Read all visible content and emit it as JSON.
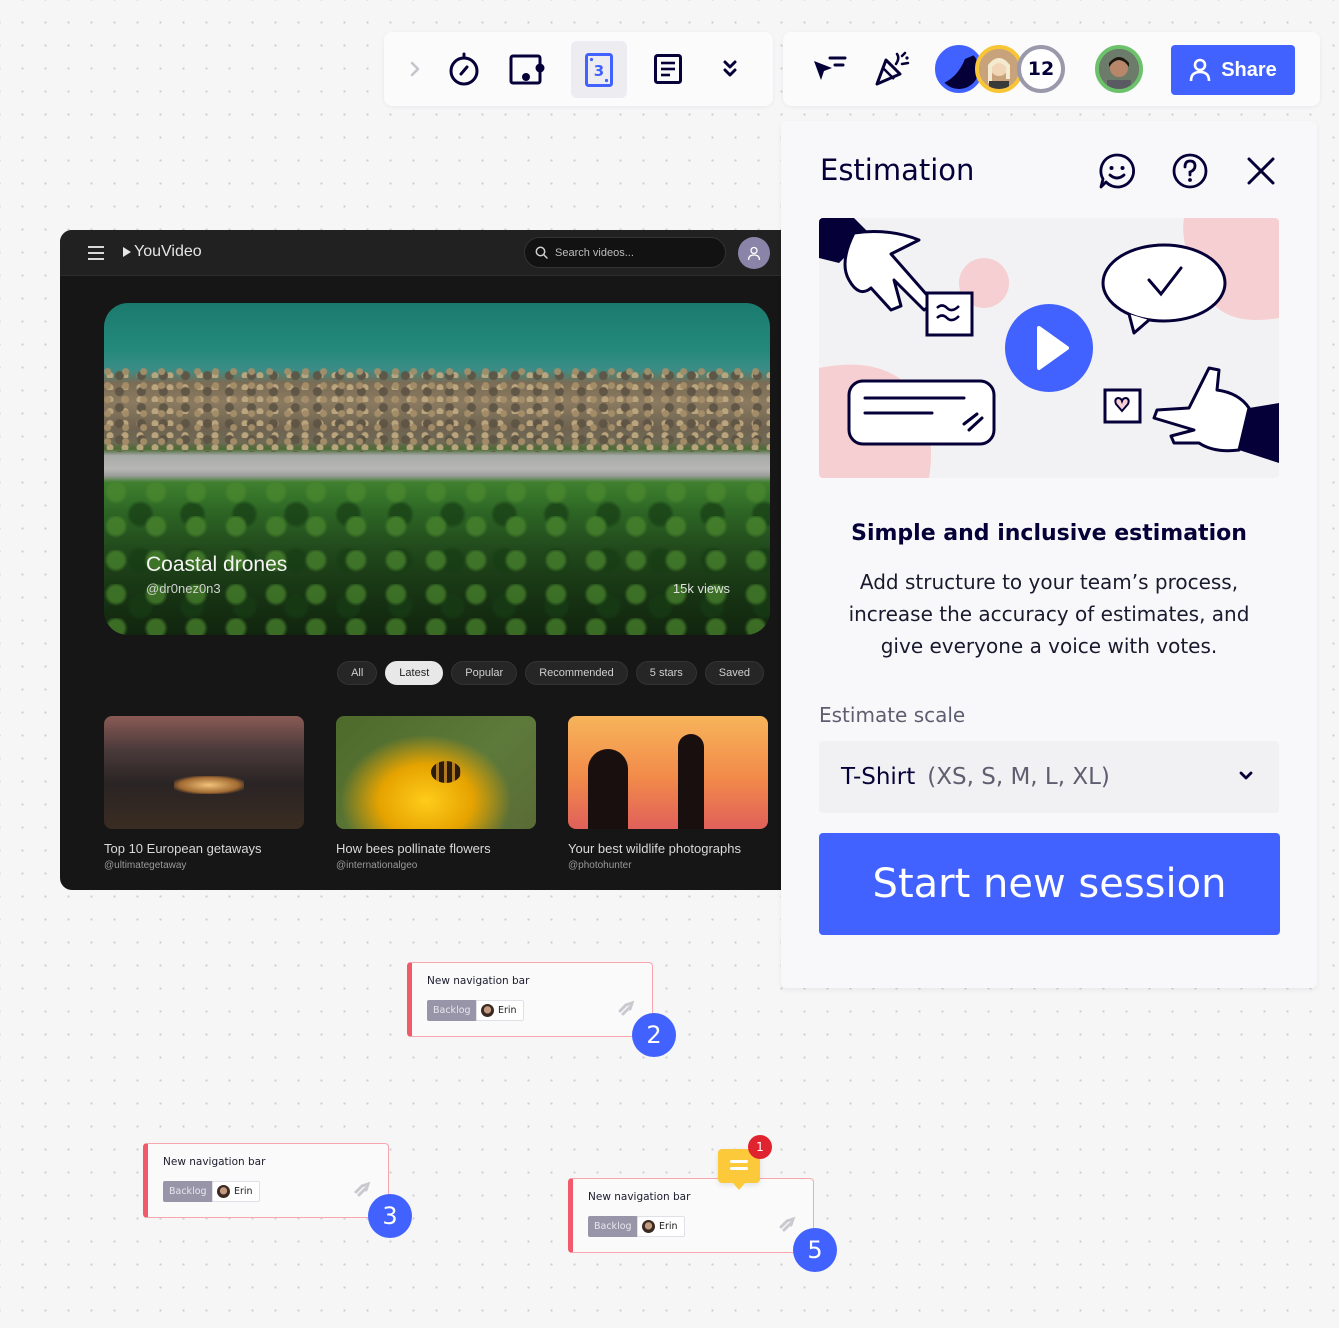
{
  "toolbar_left": {
    "items": [
      {
        "name": "expand",
        "icon": "chevron-right-icon"
      },
      {
        "name": "timer",
        "icon": "timer-icon"
      },
      {
        "name": "card-embed",
        "icon": "card-embed-icon"
      },
      {
        "name": "estimation",
        "icon": "estimation-card-icon",
        "label": "3",
        "active": true
      },
      {
        "name": "notes",
        "icon": "document-icon"
      },
      {
        "name": "more",
        "icon": "double-chevron-down-icon"
      }
    ]
  },
  "toolbar_right": {
    "collaborators_overflow_count": "12",
    "share_label": "Share",
    "colors": {
      "accent": "#4262ff",
      "avatar_ring_yellow": "#f8c537",
      "avatar_ring_green": "#6cc26a",
      "count_ring": "#9a99ab"
    }
  },
  "youvideo": {
    "app_name": "YouVideo",
    "search_placeholder": "Search videos...",
    "hero": {
      "title": "Coastal drones",
      "handle": "@dr0nez0n3",
      "views": "15k views"
    },
    "filters": [
      {
        "label": "All",
        "active": false
      },
      {
        "label": "Latest",
        "active": true
      },
      {
        "label": "Popular",
        "active": false
      },
      {
        "label": "Recommended",
        "active": false
      },
      {
        "label": "5 stars",
        "active": false
      },
      {
        "label": "Saved",
        "active": false
      }
    ],
    "videos": [
      {
        "title": "Top 10 European getaways",
        "handle": "@ultimategetaway"
      },
      {
        "title": "How bees pollinate flowers",
        "handle": "@internationalgeo"
      },
      {
        "title": "Your best wildlife photographs",
        "handle": "@photohunter"
      }
    ]
  },
  "estimation_panel": {
    "title": "Estimation",
    "subtitle": "Simple and inclusive estimation",
    "description": "Add structure to your team’s process, increase the accuracy of estimates, and give everyone a voice with votes.",
    "scale_label": "Estimate scale",
    "scale_value": "T-Shirt",
    "scale_hint": "(XS, S, M, L, XL)",
    "start_button": "Start new session"
  },
  "cards": [
    {
      "title": "New navigation bar",
      "status": "Backlog",
      "assignee": "Erin",
      "estimate": "2"
    },
    {
      "title": "New navigation bar",
      "status": "Backlog",
      "assignee": "Erin",
      "estimate": "3"
    },
    {
      "title": "New navigation bar",
      "status": "Backlog",
      "assignee": "Erin",
      "estimate": "5",
      "comments": "1"
    }
  ]
}
